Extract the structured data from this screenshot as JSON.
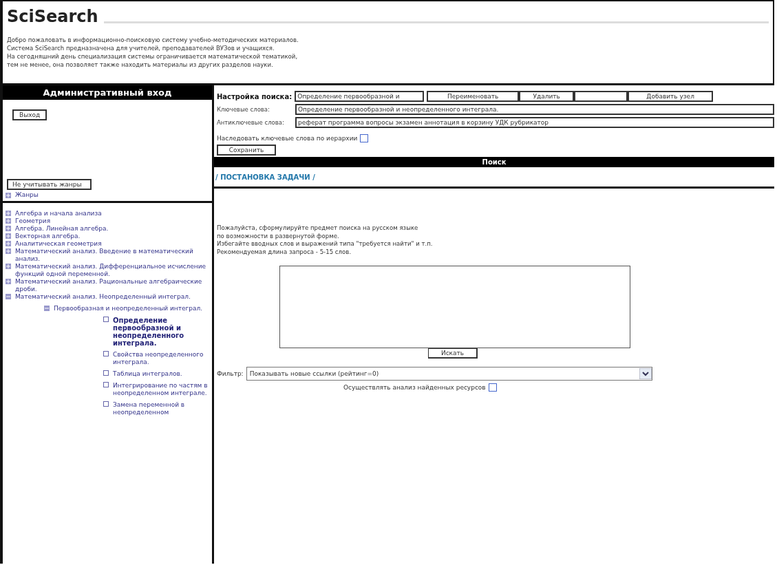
{
  "site_title": "SciSearch",
  "intro": [
    "Добро пожаловать в информационно-поисковую систему учебно-методических материалов.",
    "Система SciSearch предназначена для учителей, преподавателей ВУЗов и учащихся.",
    "На сегодняшний день специализация системы ограничивается математической тематикой,",
    "тем не менее, она позволяет также находить материалы из других разделов науки."
  ],
  "admin": {
    "title": "Административный вход",
    "logout_button": "Выход",
    "genres_button": "Не учитывать жанры",
    "genres_item": {
      "label": "Жанры",
      "expanded": false
    }
  },
  "tree": [
    {
      "label": "Алгебра и начала анализа",
      "expanded": false
    },
    {
      "label": "Геометрия",
      "expanded": false
    },
    {
      "label": "Алгебра. Линейная алгебра.",
      "expanded": false
    },
    {
      "label": "Векторная алгебра.",
      "expanded": false
    },
    {
      "label": "Аналитическая геометрия",
      "expanded": false
    },
    {
      "label": "Математический анализ. Введение в математический анализ.",
      "expanded": false
    },
    {
      "label": "Математический анализ. Дифференциальное исчисление функций одной переменной.",
      "expanded": false
    },
    {
      "label": "Математический анализ. Рациональные алгебраические дроби.",
      "expanded": false
    },
    {
      "label": "Математический анализ. Неопределенный интеграл.",
      "expanded": true,
      "children": [
        {
          "label": "Первообразная и неопределенный интеграл.",
          "expanded": true,
          "children": [
            {
              "label": "Определение первообразной и неопределенного интеграла.",
              "selected": true
            },
            {
              "label": "Свойства неопределенного интеграла.",
              "selected": false
            },
            {
              "label": "Таблица интегралов.",
              "selected": false
            },
            {
              "label": "Интегрирование по частям в неопределенном интеграле.",
              "selected": false
            },
            {
              "label": "Замена переменной в неопределенном",
              "selected": false
            }
          ]
        }
      ]
    }
  ],
  "settings": {
    "label": "Настройка поиска:",
    "name_value": "Определение первообразной и",
    "rename_button": "Переименовать",
    "delete_button": "Удалить",
    "add_button": "Добавить узел",
    "keywords_label": "Ключевые слова:",
    "keywords_value": "Определение первообразной и неопределенного интеграла.",
    "antikeywords_label": "Антиключевые слова:",
    "antikeywords_value": "реферат программа вопросы экзамен аннотация в корзину УДК рубрикатор",
    "inherit_label": "Наследовать ключевые слова по иерархии",
    "inherit_checked": false,
    "save_button": "Сохранить"
  },
  "search": {
    "title": "Поиск",
    "breadcrumb": "/ ПОСТАНОВКА ЗАДАЧИ /",
    "instructions": [
      "Пожалуйста, сформулируйте предмет поиска на русском языке",
      "по возможности в развернутой форме.",
      "Избегайте вводных слов и выражений типа \"требуется найти\" и т.п.",
      "Рекомендуемая длина запроса - 5-15 слов."
    ],
    "search_button": "Искать",
    "filter_label": "Фильтр:",
    "filter_value": "Показывать новые ссылки (рейтинг=0)",
    "analyze_label": "Осуществлять анализ найденных ресурсов",
    "analyze_checked": false
  }
}
